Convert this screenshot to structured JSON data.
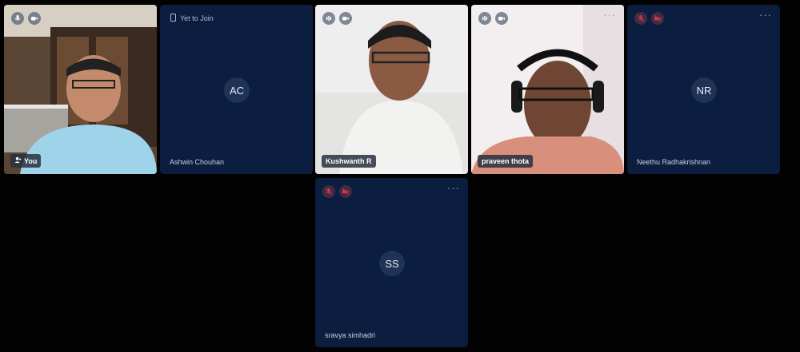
{
  "participants": [
    {
      "name": "You"
    },
    {
      "name": "Ashwin Chouhan",
      "initials": "AC",
      "status": "Yet to Join"
    },
    {
      "name": "Kushwanth R"
    },
    {
      "name": "praveen thota"
    },
    {
      "name": "Neethu Radhakrishnan",
      "initials": "NR"
    },
    {
      "name": "sravya simhadri",
      "initials": "SS"
    }
  ],
  "menu_glyph": "···",
  "colors": {
    "tile_bg": "#0b1e3f",
    "page_bg": "#020202",
    "muted": "#c23b4a"
  },
  "icons": [
    "mic-icon",
    "camera-icon",
    "audio-level-icon",
    "mic-off-icon",
    "camera-off-icon",
    "person-icon",
    "phone-icon"
  ]
}
